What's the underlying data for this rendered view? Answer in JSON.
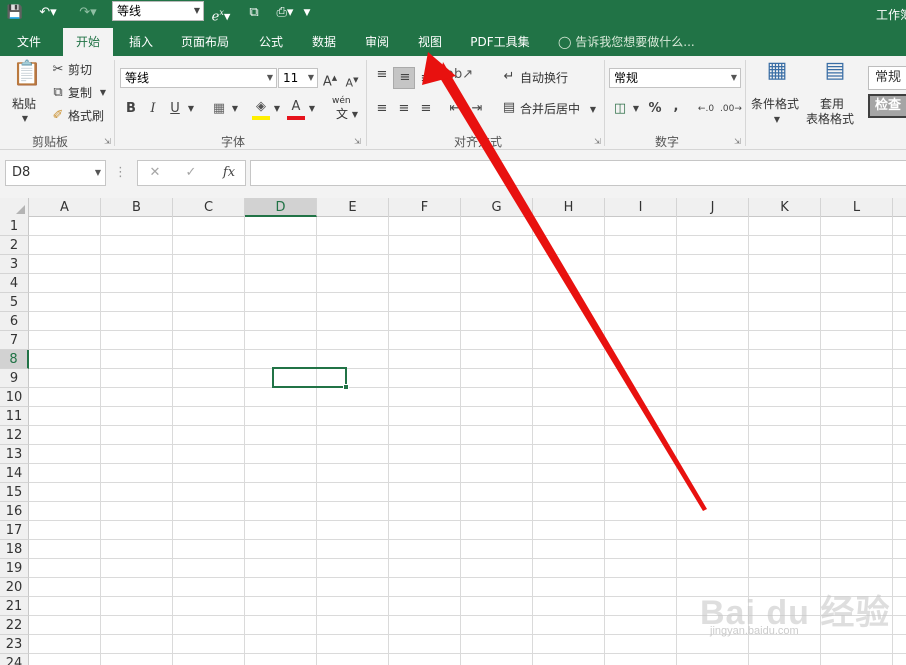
{
  "titlebar": {
    "font_value": "等线",
    "window_title": "工作簿",
    "bg_color": "#217346"
  },
  "tabs": [
    {
      "label": "文件",
      "active": false
    },
    {
      "label": "开始",
      "active": true
    },
    {
      "label": "插入",
      "active": false
    },
    {
      "label": "页面布局",
      "active": false
    },
    {
      "label": "公式",
      "active": false
    },
    {
      "label": "数据",
      "active": false
    },
    {
      "label": "审阅",
      "active": false
    },
    {
      "label": "视图",
      "active": false
    },
    {
      "label": "PDF工具集",
      "active": false
    }
  ],
  "tell_me": "告诉我您想要做什么...",
  "ribbon": {
    "clipboard": {
      "paste": "粘贴",
      "cut": "剪切",
      "copy": "复制",
      "format_painter": "格式刷",
      "label": "剪贴板"
    },
    "font": {
      "font_name": "等线",
      "font_size": "11",
      "bold": "B",
      "italic": "I",
      "underline": "U",
      "font_color_letter": "A",
      "wen": "wén",
      "wen_char": "文",
      "label": "字体"
    },
    "alignment": {
      "wrap_text": "自动换行",
      "merge_center": "合并后居中",
      "label": "对齐方式"
    },
    "number": {
      "format": "常规",
      "percent": "%",
      "comma": ",",
      "label": "数字"
    },
    "styles": {
      "conditional": "条件格式",
      "table_format_1": "套用",
      "table_format_2": "表格格式",
      "style_normal": "常规",
      "style_check": "检查"
    }
  },
  "formula_bar": {
    "name_box": "D8",
    "fx": "fx",
    "value": ""
  },
  "sheet": {
    "columns": [
      "A",
      "B",
      "C",
      "D",
      "E",
      "F",
      "G",
      "H",
      "I",
      "J",
      "K",
      "L"
    ],
    "rows": [
      "1",
      "2",
      "3",
      "4",
      "5",
      "6",
      "7",
      "8",
      "9",
      "10",
      "11",
      "12",
      "13",
      "14",
      "15",
      "16",
      "17",
      "18",
      "19",
      "20",
      "21",
      "22",
      "23",
      "24"
    ],
    "selected_column": "D",
    "selected_row": "8",
    "selection_color": "#217346"
  },
  "watermark": {
    "main": "Bai du 经验",
    "sub": "jingyan.baidu.com"
  },
  "annotation": {
    "arrow_color": "#e8110f",
    "points_to": "视图"
  }
}
